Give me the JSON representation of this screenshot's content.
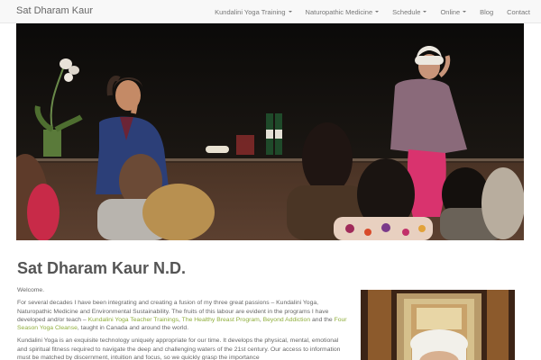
{
  "site": {
    "brand": "Sat Dharam Kaur"
  },
  "nav": {
    "items": [
      {
        "label": "Kundalini Yoga Training",
        "dropdown": true
      },
      {
        "label": "Naturopathic Medicine",
        "dropdown": true
      },
      {
        "label": "Schedule",
        "dropdown": true
      },
      {
        "label": "Online",
        "dropdown": true
      },
      {
        "label": "Blog",
        "dropdown": false
      },
      {
        "label": "Contact",
        "dropdown": false
      }
    ]
  },
  "page": {
    "title": "Sat Dharam Kaur N.D.",
    "welcome": "Welcome.",
    "intro_before_links": "For several decades I have been integrating and creating a fusion of my three great passions – Kundalini Yoga, Naturopathic Medicine and Environmental Sustainability.  The fruits of this labour are evident in the programs I have developed and/or teach – ",
    "link_kundalini": "Kundalini Yoga Teacher Trainings",
    "sep1": ", ",
    "link_breast": "The Healthy Breast Program",
    "sep2": ", ",
    "link_addiction": "Beyond Addiction",
    "sep3": " and the ",
    "link_cleanse": "Four Season Yoga Cleanse",
    "intro_after_links": ", taught in Canada and around the world.",
    "para2": "Kundalini Yoga is an exquisite technology uniquely appropriate for our time. It develops the physical, mental, emotional and spiritual fitness required to navigate the deep and challenging waters of the 21st century. Our access to information must be matched by discernment, intuition and focus, so we quickly grasp the importance"
  },
  "colors": {
    "link": "#8fae3c",
    "navbar_bg": "#f8f8f8"
  },
  "icons": {
    "caret": "caret-down-icon"
  }
}
